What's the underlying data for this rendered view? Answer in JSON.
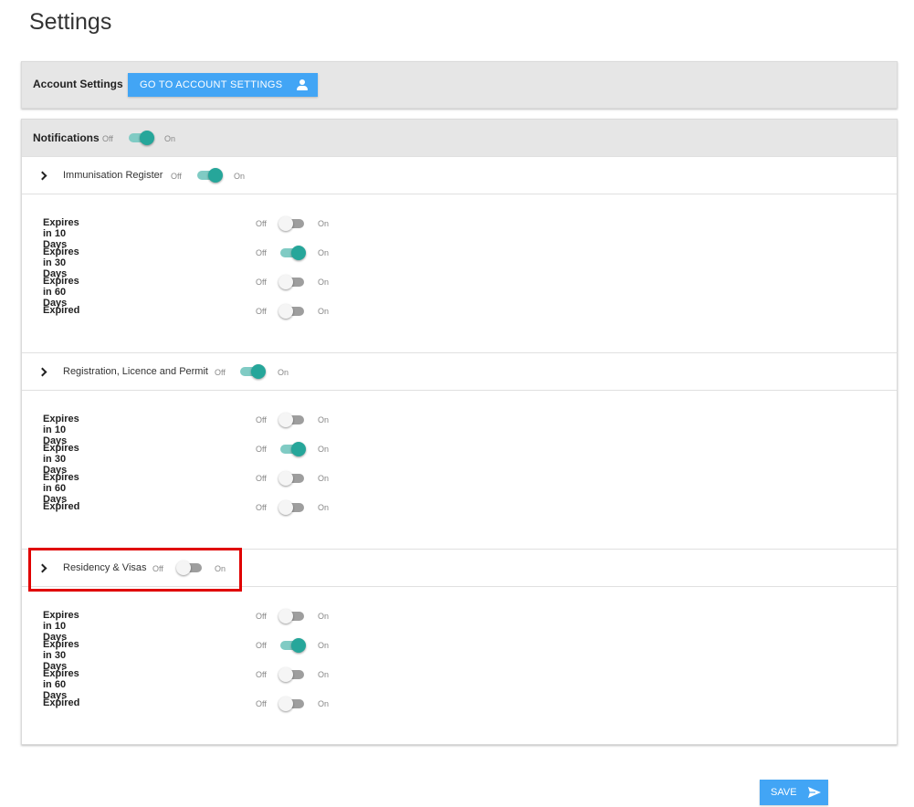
{
  "page": {
    "title": "Settings"
  },
  "account": {
    "label": "Account Settings",
    "button_label": "GO TO ACCOUNT SETTINGS",
    "button_icon": "person-icon"
  },
  "toggle_text": {
    "off": "Off",
    "on": "On"
  },
  "notifications": {
    "label": "Notifications",
    "enabled": true,
    "sections": [
      {
        "label": "Immunisation Register",
        "enabled": true,
        "rows": [
          {
            "label": "Expires in 10 Days",
            "enabled": false
          },
          {
            "label": "Expires in 30 Days",
            "enabled": true
          },
          {
            "label": "Expires in 60 Days",
            "enabled": false
          },
          {
            "label": "Expired",
            "enabled": false
          }
        ]
      },
      {
        "label": "Registration, Licence and Permit",
        "enabled": true,
        "rows": [
          {
            "label": "Expires in 10 Days",
            "enabled": false
          },
          {
            "label": "Expires in 30 Days",
            "enabled": true
          },
          {
            "label": "Expires in 60 Days",
            "enabled": false
          },
          {
            "label": "Expired",
            "enabled": false
          }
        ]
      },
      {
        "label": "Residency & Visas",
        "enabled": false,
        "highlighted": true,
        "rows": [
          {
            "label": "Expires in 10 Days",
            "enabled": false
          },
          {
            "label": "Expires in 30 Days",
            "enabled": true
          },
          {
            "label": "Expires in 60 Days",
            "enabled": false
          },
          {
            "label": "Expired",
            "enabled": false
          }
        ]
      }
    ]
  },
  "save": {
    "label": "SAVE",
    "icon": "send-icon"
  },
  "colors": {
    "accent_blue": "#42a5f5",
    "toggle_on": "#26a69a",
    "highlight": "#e00000"
  }
}
